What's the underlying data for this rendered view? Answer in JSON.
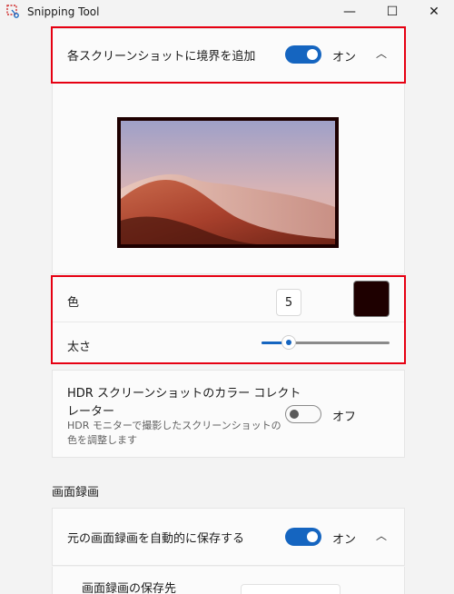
{
  "window": {
    "title": "Snipping Tool",
    "controls": {
      "minimize": "—",
      "maximize": "☐",
      "close": "✕"
    }
  },
  "border": {
    "label": "各スクリーンショットに境界を追加",
    "toggle": "オン",
    "expanded": true,
    "color_label": "色",
    "thickness_value": "5",
    "color_value": "#1e0000",
    "width_label": "太さ",
    "slider_fraction": 0.21
  },
  "hdr": {
    "label_line1": "HDR スクリーンショットのカラー コレクト",
    "label_line2": "レーター",
    "desc_line1": "HDR モニターで撮影したスクリーンショットの",
    "desc_line2": "色を調整します",
    "toggle": "オフ"
  },
  "recording": {
    "section_title": "画面録画",
    "autosave_label": "元の画面録画を自動的に保存する",
    "autosave_toggle": "オン",
    "save_location_label": "画面録画の保存先"
  },
  "colors": {
    "accent": "#1565c0",
    "highlight": "#e60012"
  }
}
